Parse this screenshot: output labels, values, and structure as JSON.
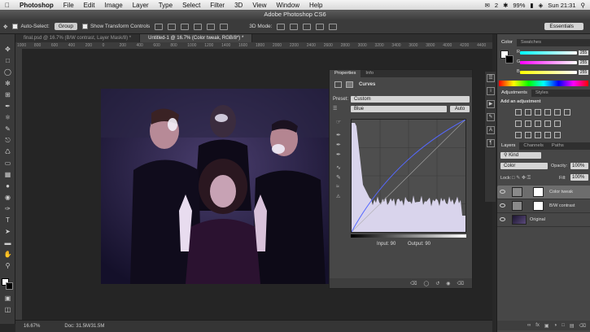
{
  "menubar": {
    "app": "Photoshop",
    "items": [
      "File",
      "Edit",
      "Image",
      "Layer",
      "Type",
      "Select",
      "Filter",
      "3D",
      "View",
      "Window",
      "Help"
    ],
    "battery": "99%",
    "clock": "Sun 21:31",
    "notification_count": "2"
  },
  "title": "Adobe Photoshop CS6",
  "options": {
    "auto_select_label": "Auto-Select:",
    "auto_select_value": "Group",
    "transform_label": "Show Transform Controls",
    "mode_label": "3D Mode:",
    "workspace": "Essentials"
  },
  "tabs": [
    {
      "label": "final.psd @ 16.7% (B/W contrast, Layer Mask/8) *"
    },
    {
      "label": "Untitled-1 @ 16.7% (Color tweak, RGB/8*) *"
    }
  ],
  "ruler_ticks": [
    "1000",
    "800",
    "600",
    "400",
    "200",
    "0",
    "200",
    "400",
    "600",
    "800",
    "1000",
    "1200",
    "1400",
    "1600",
    "1800",
    "2000",
    "2200",
    "2400",
    "2600",
    "2800",
    "3000",
    "3200",
    "3400",
    "3600",
    "3800",
    "4000",
    "4200",
    "4400"
  ],
  "status": {
    "zoom": "16.67%",
    "doc": "Doc: 31.5M/31.5M"
  },
  "properties": {
    "tabs": [
      "Properties",
      "Info"
    ],
    "adjustment_name": "Curves",
    "preset_label": "Preset:",
    "preset_value": "Custom",
    "channel_value": "Blue",
    "auto_label": "Auto",
    "input_label": "Input: 90",
    "output_label": "Output: 90"
  },
  "color_panel": {
    "tabs": [
      "Color",
      "Swatches"
    ],
    "channels": [
      {
        "label": "R",
        "value": "255",
        "color": "#ff4040"
      },
      {
        "label": "G",
        "value": "255",
        "color": "#40ff40"
      },
      {
        "label": "B",
        "value": "255",
        "color": "#4060ff"
      }
    ]
  },
  "adjustments_panel": {
    "tabs": [
      "Adjustments",
      "Styles"
    ],
    "heading": "Add an adjustment"
  },
  "layers_panel": {
    "tabs": [
      "Layers",
      "Channels",
      "Paths"
    ],
    "kind_label": "Kind",
    "blend_mode": "Color",
    "opacity_label": "Opacity:",
    "opacity_value": "100%",
    "lock_label": "Lock:",
    "fill_label": "Fill:",
    "fill_value": "100%",
    "layers": [
      {
        "name": "Color tweak",
        "selected": true
      },
      {
        "name": "B/W contrast",
        "selected": false
      },
      {
        "name": "Original",
        "selected": false
      }
    ]
  },
  "curves": {
    "channel": "Blue",
    "input": 90,
    "output": 90,
    "histogram_color": "#d9d4ec"
  }
}
